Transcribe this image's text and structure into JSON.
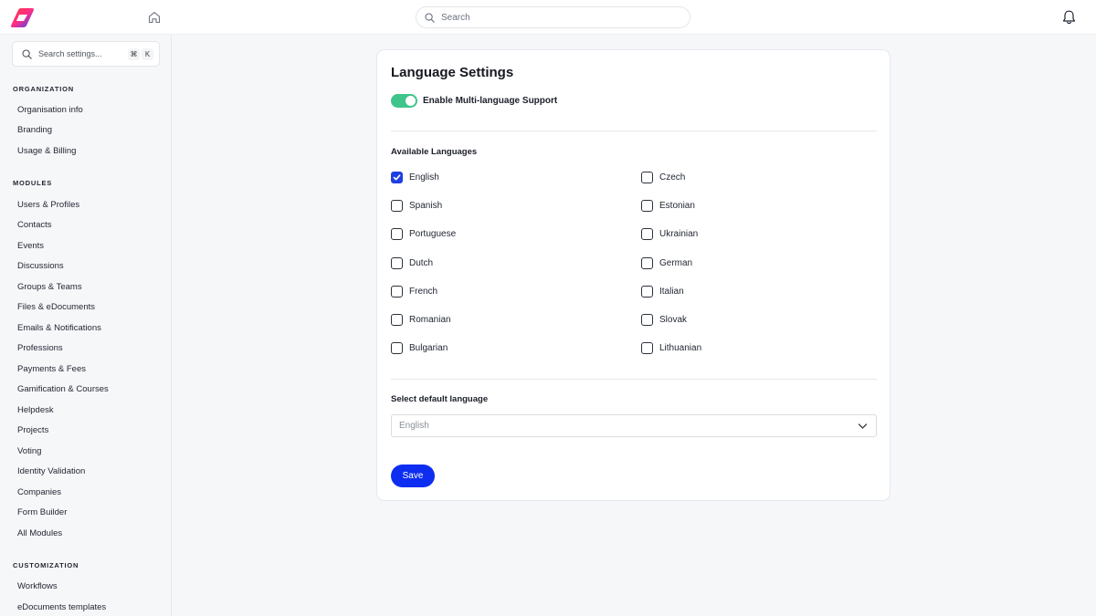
{
  "header": {
    "logo_icon": "app-logo-icon",
    "home_icon": "home-icon",
    "search_placeholder": "Search",
    "notifications_icon": "bell-icon"
  },
  "sidebar": {
    "search_placeholder": "Search settings...",
    "shortcut_keys": [
      "⌘",
      "K"
    ],
    "sections": [
      {
        "title": "ORGANIZATION",
        "items": [
          "Organisation info",
          "Branding",
          "Usage & Billing"
        ]
      },
      {
        "title": "MODULES",
        "items": [
          "Users & Profiles",
          "Contacts",
          "Events",
          "Discussions",
          "Groups & Teams",
          "Files & eDocuments",
          "Emails & Notifications",
          "Professions",
          "Payments & Fees",
          "Gamification & Courses",
          "Helpdesk",
          "Projects",
          "Voting",
          "Identity Validation",
          "Companies",
          "Form Builder",
          "All Modules"
        ]
      },
      {
        "title": "CUSTOMIZATION",
        "items": [
          "Workflows",
          "eDocuments templates"
        ]
      }
    ]
  },
  "card": {
    "title": "Language Settings",
    "toggle_label": "Enable Multi-language Support",
    "toggle_on": true,
    "languages_title": "Available Languages",
    "languages": [
      {
        "label": "English",
        "checked": true
      },
      {
        "label": "Spanish",
        "checked": false
      },
      {
        "label": "Portuguese",
        "checked": false
      },
      {
        "label": "Dutch",
        "checked": false
      },
      {
        "label": "French",
        "checked": false
      },
      {
        "label": "Romanian",
        "checked": false
      },
      {
        "label": "Bulgarian",
        "checked": false
      },
      {
        "label": "Czech",
        "checked": false
      },
      {
        "label": "Estonian",
        "checked": false
      },
      {
        "label": "Ukrainian",
        "checked": false
      },
      {
        "label": "German",
        "checked": false
      },
      {
        "label": "Italian",
        "checked": false
      },
      {
        "label": "Slovak",
        "checked": false
      },
      {
        "label": "Lithuanian",
        "checked": false
      }
    ],
    "default_label": "Select default language",
    "default_value": "English",
    "save_label": "Save"
  },
  "colors": {
    "accent": "#1f3fe0",
    "save_button": "#0d2df0",
    "toggle_on": "#3fc58c"
  }
}
